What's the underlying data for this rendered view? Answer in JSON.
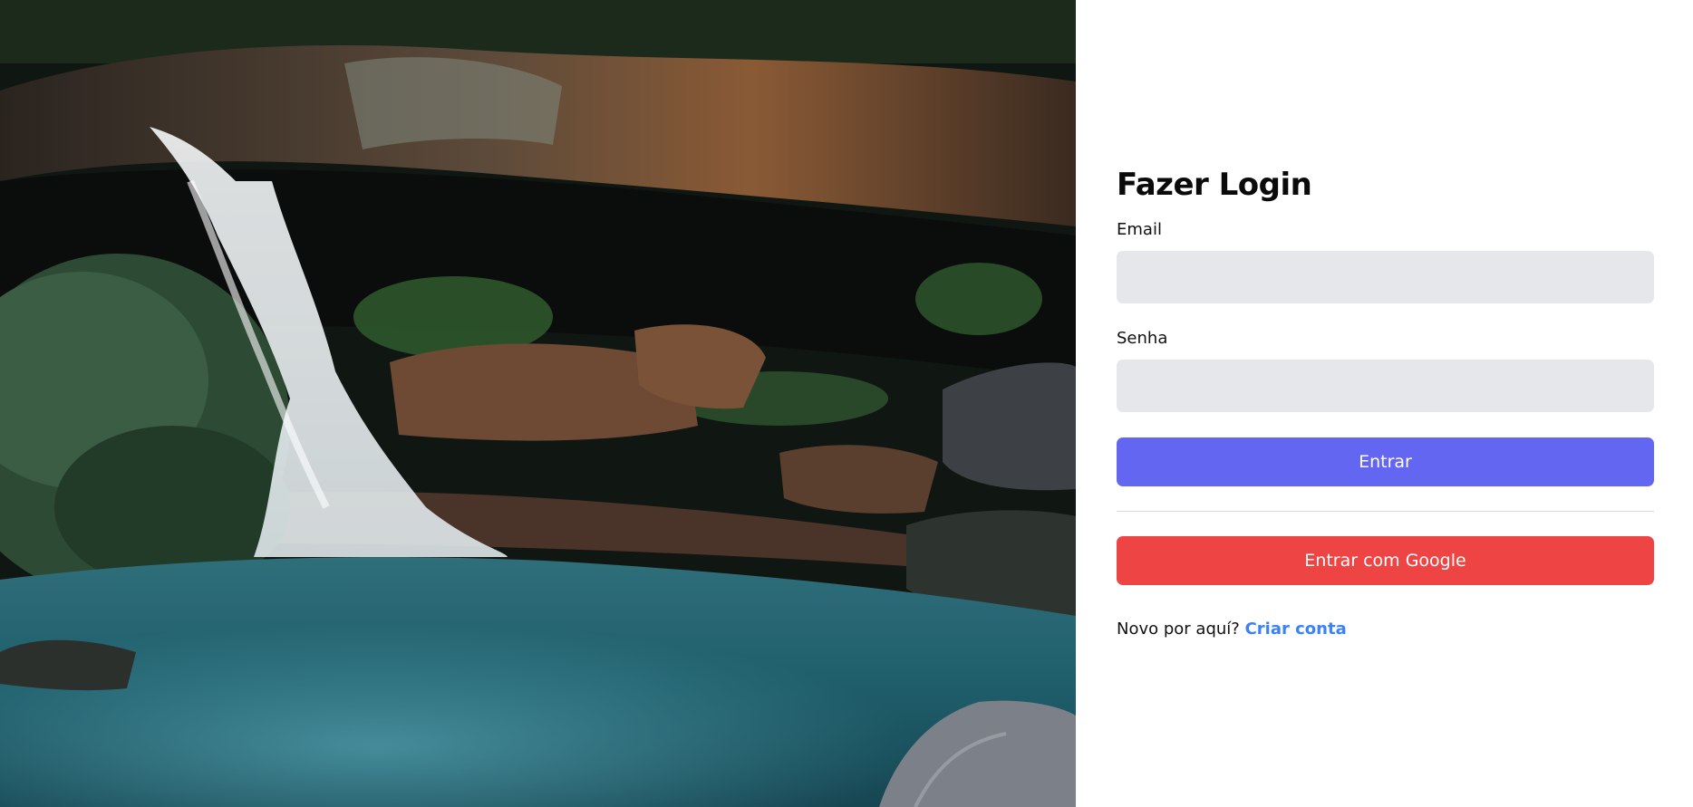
{
  "login": {
    "title": "Fazer Login",
    "email_label": "Email",
    "email_value": "",
    "password_label": "Senha",
    "password_value": "",
    "submit_label": "Entrar",
    "google_label": "Entrar com Google",
    "signup_prompt": "Novo por aquí?",
    "signup_link": "Criar conta"
  },
  "colors": {
    "primary": "#6366f1",
    "google": "#ef4444",
    "link": "#3b82f6",
    "input_bg": "#e6e7ea"
  },
  "hero_image": {
    "subject": "waterfall-pool-photo"
  }
}
